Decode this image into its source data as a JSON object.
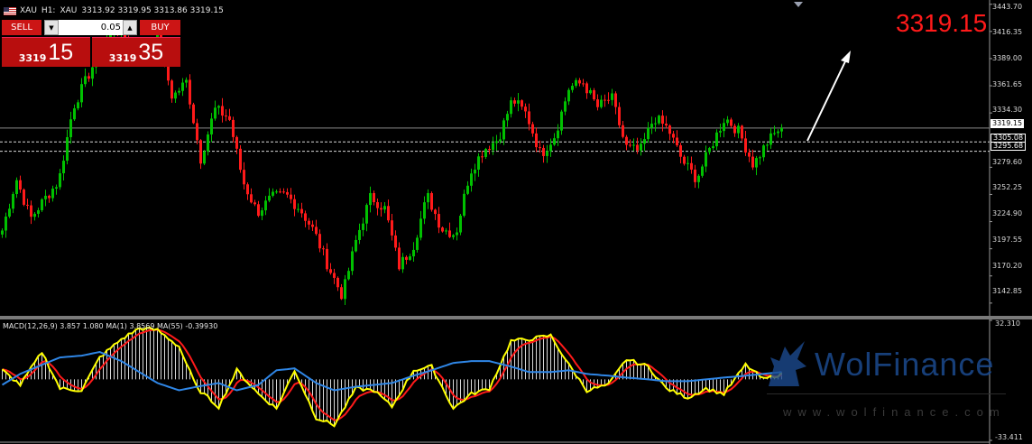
{
  "header": {
    "symbol": "XAU",
    "timeframe": "H1:",
    "symbol_desc": "XAU",
    "ohlc": "3313.92 3319.95 3313.86 3319.15"
  },
  "trade_panel": {
    "sell_label": "SELL",
    "buy_label": "BUY",
    "lot_value": "0.05",
    "sell_price_small": "3319",
    "sell_price_big": "15",
    "buy_price_small": "3319",
    "buy_price_big": "35"
  },
  "current_price": "3319.15",
  "price_boxes": {
    "current": "3319.15",
    "level1": "3305.08",
    "level2": "3295.68"
  },
  "macd_label": "MACD(12,26,9) 3.857 1.080 MA(1) 3.8569 MA(55) -0.39930",
  "price_axis": [
    "3443.70",
    "3416.35",
    "3389.00",
    "3361.65",
    "3334.30",
    "3279.60",
    "3252.25",
    "3224.90",
    "3197.55",
    "3170.20",
    "3142.85"
  ],
  "macd_axis": [
    "32.310",
    "-33.411"
  ],
  "watermark": {
    "brand": "WolFinance",
    "url": "www.wolfinance.com"
  },
  "colors": {
    "bull": "#00c000",
    "bear": "#ff1a1a",
    "macd_line": "#ffff00",
    "signal_line": "#ff1a1a",
    "ma_line": "#2f86e6",
    "arrow": "#ffffff"
  },
  "chart_data": [
    {
      "type": "candlestick",
      "title": "",
      "y_range": [
        3130,
        3448
      ],
      "y_ticks": [
        3443.7,
        3416.35,
        3389.0,
        3361.65,
        3334.3,
        3279.6,
        3252.25,
        3224.9,
        3197.55,
        3170.2,
        3142.85
      ],
      "anchors_close": [
        3216,
        3268,
        3228,
        3248,
        3266,
        3340,
        3370,
        3400,
        3420,
        3402,
        3390,
        3410,
        3350,
        3366,
        3288,
        3338,
        3330,
        3265,
        3234,
        3249,
        3252,
        3238,
        3215,
        3180,
        3150,
        3208,
        3250,
        3238,
        3180,
        3200,
        3251,
        3218,
        3212,
        3275,
        3298,
        3308,
        3348,
        3333,
        3292,
        3312,
        3360,
        3365,
        3340,
        3350,
        3300,
        3295,
        3330,
        3318,
        3286,
        3268,
        3300,
        3330,
        3315,
        3282,
        3305,
        3321
      ],
      "levels": [
        3319.15,
        3305.08,
        3295.68
      ]
    },
    {
      "type": "line",
      "title": "",
      "y_range": [
        -33.411,
        32.31
      ],
      "x": [
        0,
        5,
        11,
        16,
        22,
        27,
        33,
        38,
        43,
        49,
        54,
        60,
        65,
        71,
        76,
        81,
        87,
        92,
        98,
        103,
        108,
        114,
        119,
        125,
        130,
        135,
        141,
        146,
        152,
        157,
        162,
        168,
        173,
        179,
        184,
        190,
        195,
        200,
        206,
        211,
        216
      ],
      "series": [
        {
          "name": "",
          "values": [
            5,
            -3,
            15,
            -5,
            -6,
            12,
            22,
            28,
            27,
            18,
            -5,
            -15,
            5,
            -8,
            -16,
            5,
            -21,
            -25,
            -5,
            -6,
            -15,
            5,
            7,
            -16,
            -8,
            -5,
            21,
            22,
            24,
            8,
            -6,
            -3,
            11,
            7,
            -5,
            -10,
            -5,
            -8,
            8,
            0,
            3
          ]
        },
        {
          "name": "",
          "values": [
            -3,
            3,
            8,
            12,
            13,
            15,
            10,
            4,
            -2,
            -6,
            -4,
            -2,
            -6,
            -3,
            5,
            6,
            -2,
            -6,
            -4,
            -3,
            -2,
            2,
            5,
            9,
            10,
            10,
            7,
            4,
            4,
            5,
            3,
            2,
            1,
            0,
            -1,
            -1,
            0,
            1,
            2,
            3,
            4
          ]
        }
      ]
    }
  ]
}
